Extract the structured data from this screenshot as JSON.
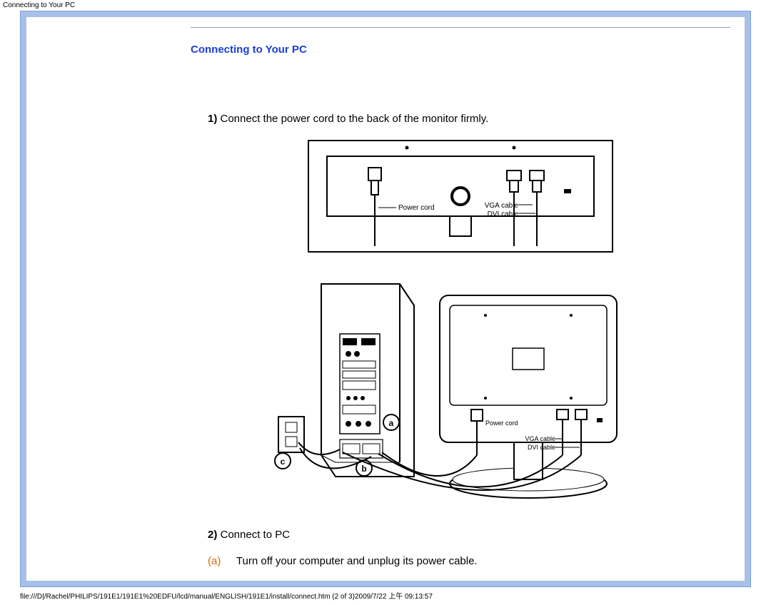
{
  "header": {
    "page_label": "Connecting to Your PC"
  },
  "content": {
    "section_title": "Connecting to Your PC",
    "step1_num": "1)",
    "step1_text": " Connect the power cord to the back of the monitor firmly.",
    "step2_num": "2)",
    "step2_text": " Connect to PC",
    "sub_a_letter": "(a)",
    "sub_a_text": "Turn off your computer and unplug its power cable."
  },
  "diagram1": {
    "power_cord": "Power cord",
    "vga_cable": "VGA cable",
    "dvi_cable": "DVI cable"
  },
  "diagram2": {
    "power_cord": "Power cord",
    "vga_cable": "VGA cable",
    "dvi_cable": "DVI cable",
    "a": "a",
    "b": "b",
    "c": "c"
  },
  "footer": {
    "path": "file:///D|/Rachel/PHILIPS/191E1/191E1%20EDFU/lcd/manual/ENGLISH/191E1/install/connect.htm (2 of 3)2009/7/22 上午 09:13:57"
  }
}
